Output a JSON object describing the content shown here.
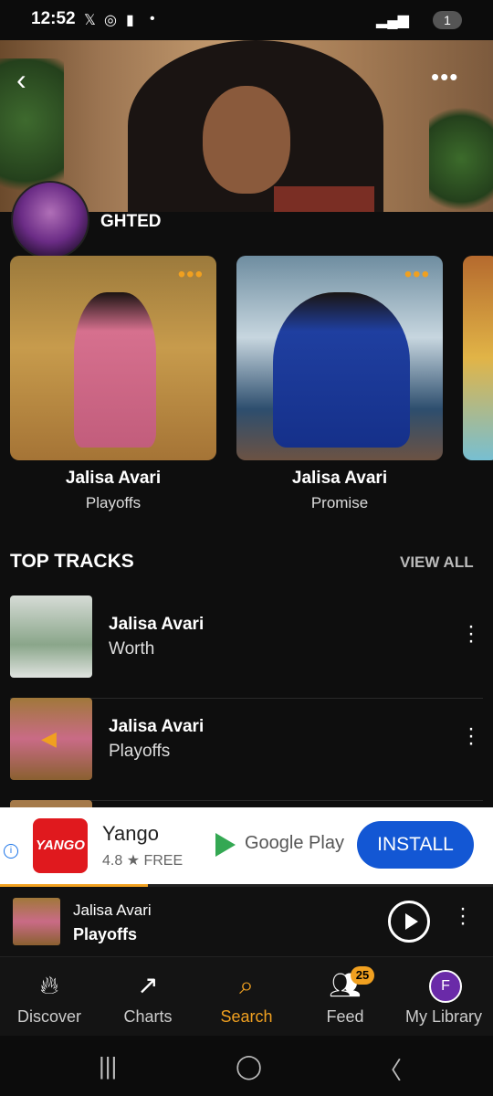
{
  "status_bar": {
    "time": "12:52",
    "battery_badge": "1"
  },
  "hero": {
    "more_label": "•••"
  },
  "section": {
    "title_partial": "GHTED"
  },
  "cards": [
    {
      "artist": "Jalisa Avari",
      "track": "Playoffs"
    },
    {
      "artist": "Jalisa Avari",
      "track": "Promise"
    }
  ],
  "top_tracks": {
    "title": "TOP TRACKS",
    "view_all": "VIEW ALL",
    "items": [
      {
        "artist": "Jalisa Avari",
        "track": "Worth"
      },
      {
        "artist": "Jalisa Avari",
        "track": "Playoffs"
      }
    ]
  },
  "ad": {
    "logo_text": "YANGO",
    "name": "Yango",
    "rating": "4.8 ★ FREE",
    "store": "Google Play",
    "install": "INSTALL"
  },
  "now_playing": {
    "artist": "Jalisa Avari",
    "track": "Playoffs",
    "progress": 0.3
  },
  "nav": {
    "items": [
      {
        "label": "Discover",
        "icon": "flame-icon"
      },
      {
        "label": "Charts",
        "icon": "trend-icon"
      },
      {
        "label": "Search",
        "icon": "search-icon"
      },
      {
        "label": "Feed",
        "icon": "people-icon",
        "badge": "25"
      },
      {
        "label": "My Library",
        "icon": "avatar-icon",
        "avatar_letter": "F"
      }
    ],
    "active": "Search"
  },
  "colors": {
    "accent": "#f0a020",
    "install_blue": "#1357d4"
  }
}
